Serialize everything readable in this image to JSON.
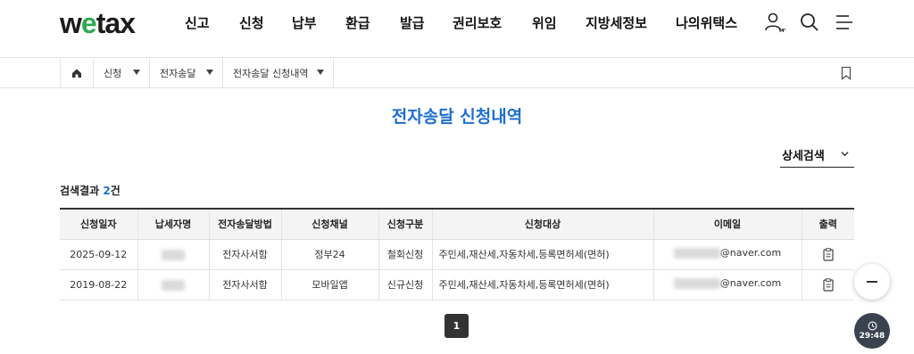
{
  "header": {
    "logo": {
      "pre": "w",
      "accent": "e",
      "post": "tax"
    },
    "nav": [
      "신고",
      "신청",
      "납부",
      "환급",
      "발급",
      "권리보호",
      "위임",
      "지방세정보",
      "나의위택스"
    ],
    "icons": {
      "my": "user-my-icon",
      "search": "search-icon",
      "menu": "menu-icon"
    },
    "my_badge": "MY"
  },
  "breadcrumb": {
    "home_icon": "home-icon",
    "items": [
      "신청",
      "전자송달",
      "전자송달 신청내역"
    ],
    "bookmark_icon": "bookmark-icon"
  },
  "page_title": "전자송달 신청내역",
  "detail_search": "상세검색",
  "result": {
    "prefix": "검색결과 ",
    "count": "2",
    "suffix": "건"
  },
  "table": {
    "headers": [
      "신청일자",
      "납세자명",
      "전자송달방법",
      "신청채널",
      "신청구분",
      "신청대상",
      "이메일",
      "출력"
    ],
    "rows": [
      {
        "date": "2025-09-12",
        "method": "전자사서함",
        "channel": "정부24",
        "type": "철회신청",
        "target": "주민세,재산세,자동차세,등록면허세(면허)",
        "email_domain": "@naver.com"
      },
      {
        "date": "2019-08-22",
        "method": "전자사서함",
        "channel": "모바일앱",
        "type": "신규신청",
        "target": "주민세,재산세,자동차세,등록면허세(면허)",
        "email_domain": "@naver.com"
      }
    ],
    "print_icon": "clipboard-print-icon"
  },
  "pagination": {
    "current": "1"
  },
  "floating": {
    "collapse_icon": "minus-icon",
    "timer_icon": "clock-icon",
    "timer": "29:48"
  },
  "colors": {
    "accent": "#1e6fd0",
    "logo_e": "#2fa84f",
    "timer_bg": "#3a4250"
  }
}
